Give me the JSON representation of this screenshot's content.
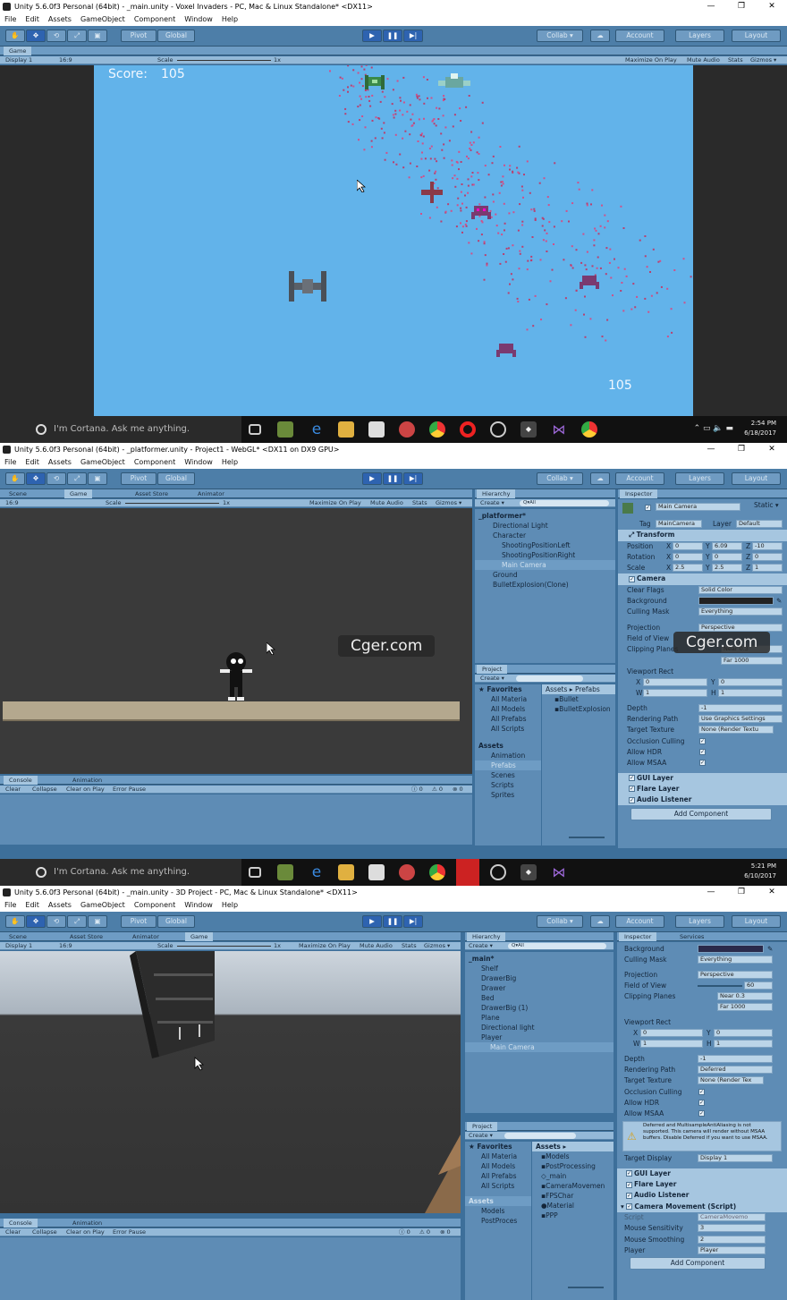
{
  "menu": [
    "File",
    "Edit",
    "Assets",
    "GameObject",
    "Component",
    "Window",
    "Help"
  ],
  "toolbar": {
    "pivot": "Pivot",
    "global": "Global",
    "collab": "Collab ▾",
    "account": "Account",
    "layers": "Layers",
    "layout": "Layout"
  },
  "shot1": {
    "title": "Unity 5.6.0f3 Personal (64bit) - _main.unity - Voxel Invaders - PC, Mac & Linux Standalone* <DX11>",
    "game_tab": "Game",
    "display": "Display 1",
    "aspect": "16:9",
    "scale_label": "Scale",
    "scale_value": "1x",
    "options": [
      "Maximize On Play",
      "Mute Audio",
      "Stats",
      "Gizmos ▾"
    ],
    "score_label": "Score:",
    "score_value": "105",
    "counter": "105"
  },
  "taskbar": {
    "cortana": "I'm Cortana. Ask me anything.",
    "time1": "2:54 PM",
    "date1": "6/18/2017",
    "time2": "5:21 PM",
    "date2": "6/10/2017"
  },
  "shot2": {
    "title": "Unity 5.6.0f3 Personal (64bit) - _platformer.unity - Project1 - WebGL* <DX11 on DX9 GPU>",
    "tabs": [
      "Scene",
      "Game",
      "Asset Store",
      "Animator"
    ],
    "aspect": "16:9",
    "scale_label": "Scale",
    "scale_value": "1x",
    "options": [
      "Maximize On Play",
      "Mute Audio",
      "Stats",
      "Gizmos ▾"
    ],
    "hierarchy_tab": "Hierarchy",
    "create": "Create ▾",
    "search": "Q▾All",
    "hierarchy": [
      "_platformer*",
      "Directional Light",
      "Character",
      "ShootingPositionLeft",
      "ShootingPositionRight",
      "Main Camera",
      "Ground",
      "BulletExplosion(Clone)"
    ],
    "project_tab": "Project",
    "favorites": "Favorites",
    "fav_items": [
      "All Materia",
      "All Models",
      "All Prefabs",
      "All Scripts"
    ],
    "assets": "Assets",
    "asset_folders": [
      "Animation",
      "Prefabs",
      "Scenes",
      "Scripts",
      "Sprites"
    ],
    "path": "Assets ▸ Prefabs",
    "prefabs": [
      "Bullet",
      "BulletExplosion"
    ],
    "console_tabs": [
      "Console",
      "Animation"
    ],
    "console_btns": [
      "Clear",
      "Collapse",
      "Clear on Play",
      "Error Pause"
    ],
    "console_counts": [
      "0",
      "0",
      "0"
    ],
    "inspector_tab": "Inspector",
    "object_name": "Main Camera",
    "static": "Static ▾",
    "tag_label": "Tag",
    "tag": "MainCamera",
    "layer_label": "Layer",
    "layer": "Default",
    "transform": "Transform",
    "position": [
      "0",
      "6.09",
      "-10"
    ],
    "rotation": [
      "0",
      "0",
      "0"
    ],
    "scale": [
      "2.5",
      "2.5",
      "1"
    ],
    "camera": "Camera",
    "rows": [
      [
        "Clear Flags",
        "Solid Color"
      ],
      [
        "Background",
        ""
      ],
      [
        "Culling Mask",
        "Everything"
      ],
      [
        "Projection",
        "Perspective"
      ],
      [
        "Field of View",
        ""
      ],
      [
        "Clipping Planes",
        "Near 0.3"
      ],
      [
        "",
        "Far 1000"
      ]
    ],
    "viewport": "Viewport Rect",
    "vp": [
      "0",
      "0",
      "1",
      "1"
    ],
    "rows2": [
      [
        "Depth",
        "-1"
      ],
      [
        "Rendering Path",
        "Use Graphics Settings"
      ],
      [
        "Target Texture",
        "None (Render Textu"
      ],
      [
        "Occlusion Culling",
        "✓"
      ],
      [
        "Allow HDR",
        "✓"
      ],
      [
        "Allow MSAA",
        "✓"
      ]
    ],
    "components": [
      "GUI Layer",
      "Flare Layer",
      "Audio Listener"
    ],
    "add_component": "Add Component",
    "watermark": "Cger.com"
  },
  "shot3": {
    "title": "Unity 5.6.0f3 Personal (64bit) - _main.unity - 3D Project - PC, Mac & Linux Standalone* <DX11>",
    "tabs": [
      "Scene",
      "Asset Store",
      "Animator",
      "Game"
    ],
    "display": "Display 1",
    "aspect": "16:9",
    "scale_label": "Scale",
    "scale_value": "1x",
    "options": [
      "Maximize On Play",
      "Mute Audio",
      "Stats",
      "Gizmos ▾"
    ],
    "hierarchy_tab": "Hierarchy",
    "create": "Create ▾",
    "search": "Q▾All",
    "hierarchy": [
      "_main*",
      "Shelf",
      "DrawerBig",
      "Drawer",
      "Bed",
      "DrawerBig (1)",
      "Plane",
      "Directional light",
      "Player",
      "Main Camera"
    ],
    "project_tab": "Project",
    "favorites": "Favorites",
    "fav_items": [
      "All Materia",
      "All Models",
      "All Prefabs",
      "All Scripts"
    ],
    "assets": "Assets",
    "asset_folders": [
      "Models",
      "PostProces"
    ],
    "path": "Assets ▸",
    "asset_items": [
      "Models",
      "PostProcessing",
      "_main",
      "CameraMovemen",
      "FPSChar",
      "Material",
      "PPP"
    ],
    "console_tabs": [
      "Console",
      "Animation"
    ],
    "console_btns": [
      "Clear",
      "Collapse",
      "Clear on Play",
      "Error Pause"
    ],
    "console_counts": [
      "0",
      "0",
      "0"
    ],
    "inspector_tab": "Inspector",
    "services_tab": "Services",
    "rows": [
      [
        "Background",
        ""
      ],
      [
        "Culling Mask",
        "Everything"
      ],
      [
        "Projection",
        "Perspective"
      ],
      [
        "Field of View",
        "60"
      ],
      [
        "Clipping Planes",
        "Near 0.3"
      ],
      [
        "",
        "Far 1000"
      ]
    ],
    "viewport": "Viewport Rect",
    "vp": [
      "0",
      "0",
      "1",
      "1"
    ],
    "rows2": [
      [
        "Depth",
        "-1"
      ],
      [
        "Rendering Path",
        "Deferred"
      ],
      [
        "Target Texture",
        "None (Render Tex"
      ],
      [
        "Occlusion Culling",
        "✓"
      ],
      [
        "Allow HDR",
        "✓"
      ],
      [
        "Allow MSAA",
        "✓"
      ]
    ],
    "warning": "Deferred and MultisampleAntiAliasing is not supported. This camera will render without MSAA buffers. Disable Deferred if you want to use MSAA.",
    "target_display_label": "Target Display",
    "target_display": "Display 1",
    "components": [
      "GUI Layer",
      "Flare Layer",
      "Audio Listener",
      "Camera Movement (Script)"
    ],
    "script_label": "Script",
    "script": "CameraMovemo",
    "rows3": [
      [
        "Mouse Sensitivity",
        "3"
      ],
      [
        "Mouse Smoothing",
        "2"
      ],
      [
        "Player",
        "Player"
      ]
    ],
    "add_component": "Add Component"
  },
  "colors": {
    "accent": "#2e63b0",
    "game_sky": "#62b3ea",
    "panel": "#4d7ea8"
  }
}
